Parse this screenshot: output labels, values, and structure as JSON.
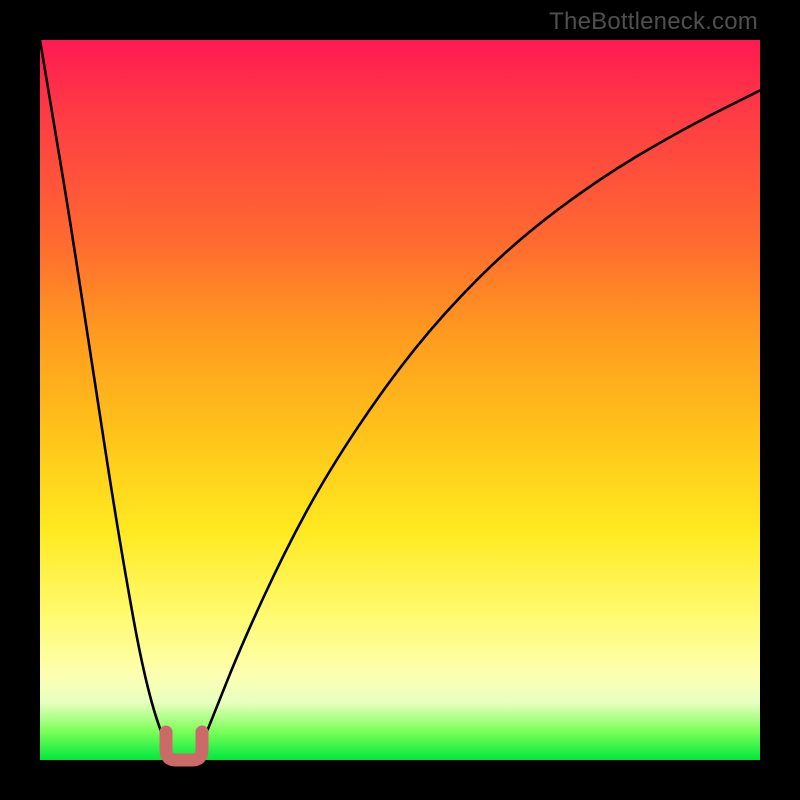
{
  "watermark": "TheBottleneck.com",
  "chart_data": {
    "type": "line",
    "title": "",
    "xlabel": "",
    "ylabel": "",
    "xlim": [
      0,
      100
    ],
    "ylim": [
      0,
      100
    ],
    "series": [
      {
        "name": "bottleneck-curve",
        "x": [
          0,
          2,
          4,
          6,
          8,
          10,
          12,
          14,
          16,
          18,
          19,
          20,
          21,
          22,
          24,
          28,
          34,
          40,
          48,
          56,
          66,
          78,
          90,
          100
        ],
        "values": [
          100,
          88,
          76,
          63,
          50,
          37,
          25,
          14,
          6,
          1,
          0.3,
          0,
          0.3,
          1,
          6,
          16,
          29,
          40,
          52,
          62,
          72,
          81,
          88,
          93
        ]
      }
    ],
    "annotations": [
      {
        "name": "min-marker",
        "x": 20,
        "y": 0,
        "shape": "u-band",
        "color": "#cc6a6a"
      }
    ],
    "grid": false,
    "legend": false
  },
  "colors": {
    "curve": "#000000",
    "marker": "#cc6a6a",
    "frame": "#000000"
  }
}
